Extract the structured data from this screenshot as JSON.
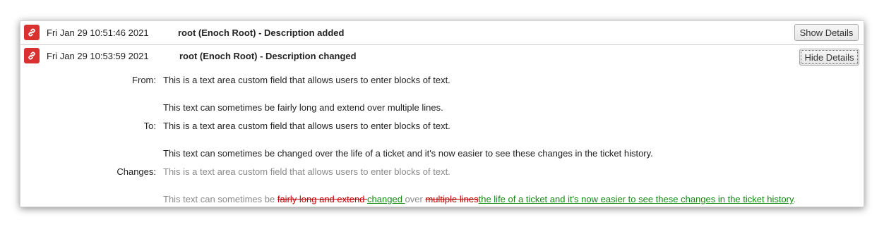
{
  "history": [
    {
      "date": "Fri Jan 29 10:51:46 2021",
      "description": "root (Enoch Root) - Description added",
      "toggle_label": "Show Details"
    },
    {
      "date": "Fri Jan 29 10:53:59 2021",
      "description": "root (Enoch Root) - Description changed",
      "toggle_label": "Hide Details",
      "details": {
        "from_label": "From:",
        "from_line1": "This is a text area custom field that allows users to enter blocks of text.",
        "from_line2": "This text can sometimes be fairly long and extend over multiple lines.",
        "to_label": "To:",
        "to_line1": "This is a text area custom field that allows users to enter blocks of text.",
        "to_line2": "This text can sometimes be changed over the life of a ticket and it's now easier to see these changes in the ticket history.",
        "changes_label": "Changes:",
        "changes_line1": "This is a text area custom field that allows users to enter blocks of text.",
        "changes_line2": {
          "prefix": "This text can sometimes be ",
          "deleted1": "fairly long and extend ",
          "inserted1": "changed ",
          "middle": "over ",
          "deleted2": "multiple lines",
          "inserted2": "the life of a ticket and it's now easier to see these changes in the ticket history",
          "suffix": "."
        }
      }
    }
  ],
  "colors": {
    "link_badge": "#d93030",
    "deleted": "#c00000",
    "inserted": "#128a12",
    "unchanged": "#8a8a8a"
  },
  "icons": {
    "link": "link-icon"
  }
}
